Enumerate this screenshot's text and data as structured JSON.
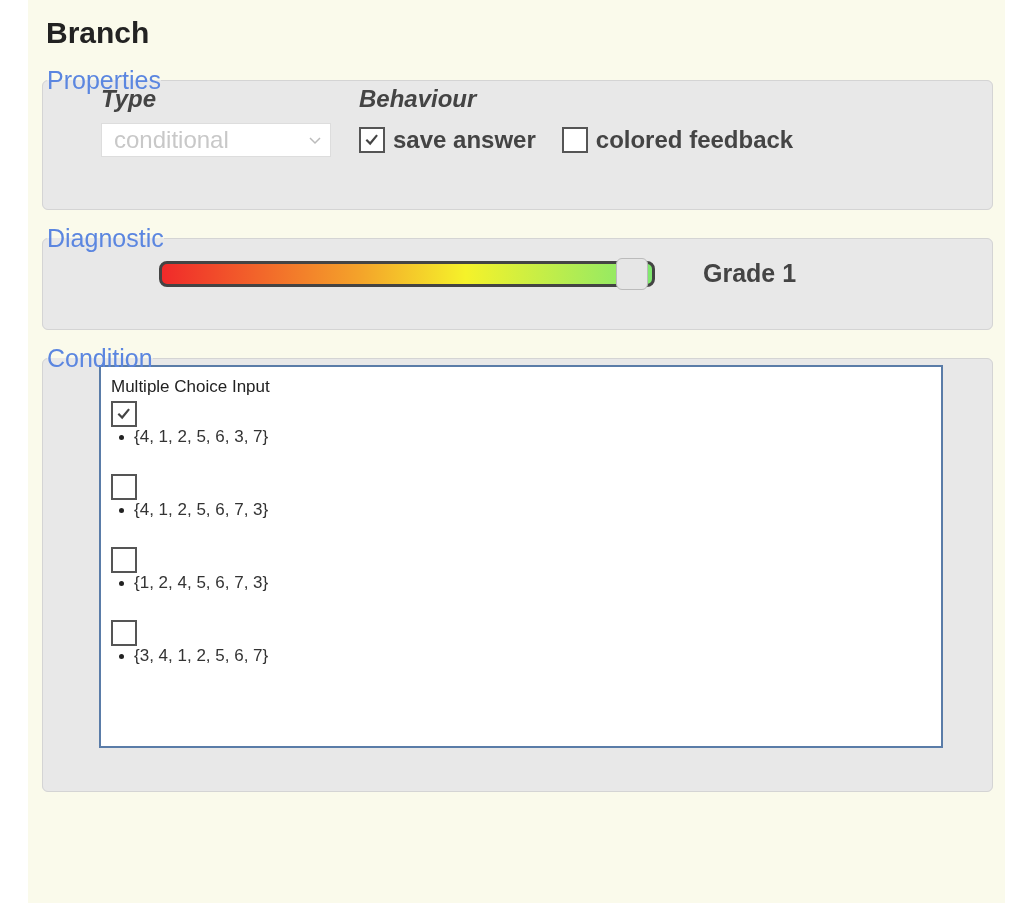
{
  "title": "Branch",
  "properties": {
    "legend": "Properties",
    "type_label": "Type",
    "type_value": "conditional",
    "type_disabled": true,
    "behaviour_label": "Behaviour",
    "options": [
      {
        "label": "save answer",
        "checked": true
      },
      {
        "label": "colored feedback",
        "checked": false
      }
    ]
  },
  "diagnostic": {
    "legend": "Diagnostic",
    "level": 0.96,
    "reading": "Grade 1"
  },
  "condition": {
    "legend": "Condition",
    "input_title": "Multiple Choice Input",
    "choices": [
      {
        "text": "{4, 1, 2, 5, 6, 3, 7}",
        "checked": true
      },
      {
        "text": "{4, 1, 2, 5, 6, 7, 3}",
        "checked": false
      },
      {
        "text": "{1, 2, 4, 5, 6, 7, 3}",
        "checked": false
      },
      {
        "text": "{3, 4, 1, 2, 5, 6, 7}",
        "checked": false
      }
    ]
  }
}
